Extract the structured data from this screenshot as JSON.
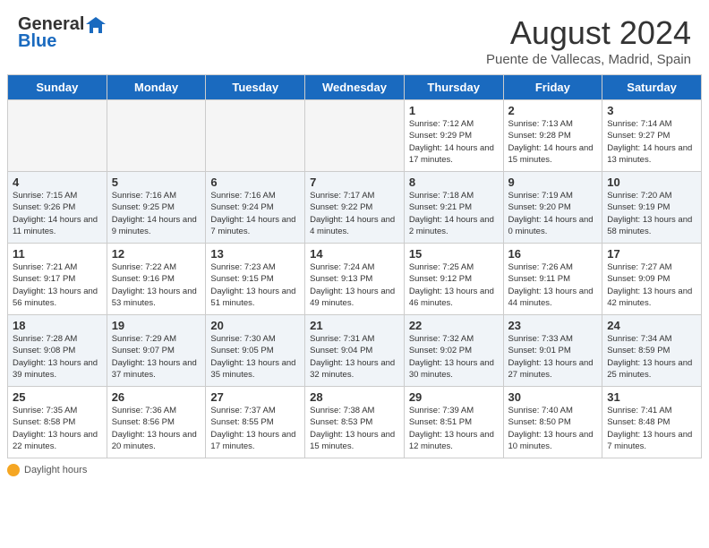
{
  "header": {
    "logo_line1": "General",
    "logo_line2": "Blue",
    "month_year": "August 2024",
    "location": "Puente de Vallecas, Madrid, Spain"
  },
  "days_of_week": [
    "Sunday",
    "Monday",
    "Tuesday",
    "Wednesday",
    "Thursday",
    "Friday",
    "Saturday"
  ],
  "weeks": [
    [
      {
        "day": "",
        "info": ""
      },
      {
        "day": "",
        "info": ""
      },
      {
        "day": "",
        "info": ""
      },
      {
        "day": "",
        "info": ""
      },
      {
        "day": "1",
        "info": "Sunrise: 7:12 AM\nSunset: 9:29 PM\nDaylight: 14 hours and 17 minutes."
      },
      {
        "day": "2",
        "info": "Sunrise: 7:13 AM\nSunset: 9:28 PM\nDaylight: 14 hours and 15 minutes."
      },
      {
        "day": "3",
        "info": "Sunrise: 7:14 AM\nSunset: 9:27 PM\nDaylight: 14 hours and 13 minutes."
      }
    ],
    [
      {
        "day": "4",
        "info": "Sunrise: 7:15 AM\nSunset: 9:26 PM\nDaylight: 14 hours and 11 minutes."
      },
      {
        "day": "5",
        "info": "Sunrise: 7:16 AM\nSunset: 9:25 PM\nDaylight: 14 hours and 9 minutes."
      },
      {
        "day": "6",
        "info": "Sunrise: 7:16 AM\nSunset: 9:24 PM\nDaylight: 14 hours and 7 minutes."
      },
      {
        "day": "7",
        "info": "Sunrise: 7:17 AM\nSunset: 9:22 PM\nDaylight: 14 hours and 4 minutes."
      },
      {
        "day": "8",
        "info": "Sunrise: 7:18 AM\nSunset: 9:21 PM\nDaylight: 14 hours and 2 minutes."
      },
      {
        "day": "9",
        "info": "Sunrise: 7:19 AM\nSunset: 9:20 PM\nDaylight: 14 hours and 0 minutes."
      },
      {
        "day": "10",
        "info": "Sunrise: 7:20 AM\nSunset: 9:19 PM\nDaylight: 13 hours and 58 minutes."
      }
    ],
    [
      {
        "day": "11",
        "info": "Sunrise: 7:21 AM\nSunset: 9:17 PM\nDaylight: 13 hours and 56 minutes."
      },
      {
        "day": "12",
        "info": "Sunrise: 7:22 AM\nSunset: 9:16 PM\nDaylight: 13 hours and 53 minutes."
      },
      {
        "day": "13",
        "info": "Sunrise: 7:23 AM\nSunset: 9:15 PM\nDaylight: 13 hours and 51 minutes."
      },
      {
        "day": "14",
        "info": "Sunrise: 7:24 AM\nSunset: 9:13 PM\nDaylight: 13 hours and 49 minutes."
      },
      {
        "day": "15",
        "info": "Sunrise: 7:25 AM\nSunset: 9:12 PM\nDaylight: 13 hours and 46 minutes."
      },
      {
        "day": "16",
        "info": "Sunrise: 7:26 AM\nSunset: 9:11 PM\nDaylight: 13 hours and 44 minutes."
      },
      {
        "day": "17",
        "info": "Sunrise: 7:27 AM\nSunset: 9:09 PM\nDaylight: 13 hours and 42 minutes."
      }
    ],
    [
      {
        "day": "18",
        "info": "Sunrise: 7:28 AM\nSunset: 9:08 PM\nDaylight: 13 hours and 39 minutes."
      },
      {
        "day": "19",
        "info": "Sunrise: 7:29 AM\nSunset: 9:07 PM\nDaylight: 13 hours and 37 minutes."
      },
      {
        "day": "20",
        "info": "Sunrise: 7:30 AM\nSunset: 9:05 PM\nDaylight: 13 hours and 35 minutes."
      },
      {
        "day": "21",
        "info": "Sunrise: 7:31 AM\nSunset: 9:04 PM\nDaylight: 13 hours and 32 minutes."
      },
      {
        "day": "22",
        "info": "Sunrise: 7:32 AM\nSunset: 9:02 PM\nDaylight: 13 hours and 30 minutes."
      },
      {
        "day": "23",
        "info": "Sunrise: 7:33 AM\nSunset: 9:01 PM\nDaylight: 13 hours and 27 minutes."
      },
      {
        "day": "24",
        "info": "Sunrise: 7:34 AM\nSunset: 8:59 PM\nDaylight: 13 hours and 25 minutes."
      }
    ],
    [
      {
        "day": "25",
        "info": "Sunrise: 7:35 AM\nSunset: 8:58 PM\nDaylight: 13 hours and 22 minutes."
      },
      {
        "day": "26",
        "info": "Sunrise: 7:36 AM\nSunset: 8:56 PM\nDaylight: 13 hours and 20 minutes."
      },
      {
        "day": "27",
        "info": "Sunrise: 7:37 AM\nSunset: 8:55 PM\nDaylight: 13 hours and 17 minutes."
      },
      {
        "day": "28",
        "info": "Sunrise: 7:38 AM\nSunset: 8:53 PM\nDaylight: 13 hours and 15 minutes."
      },
      {
        "day": "29",
        "info": "Sunrise: 7:39 AM\nSunset: 8:51 PM\nDaylight: 13 hours and 12 minutes."
      },
      {
        "day": "30",
        "info": "Sunrise: 7:40 AM\nSunset: 8:50 PM\nDaylight: 13 hours and 10 minutes."
      },
      {
        "day": "31",
        "info": "Sunrise: 7:41 AM\nSunset: 8:48 PM\nDaylight: 13 hours and 7 minutes."
      }
    ]
  ],
  "footer": {
    "daylight_label": "Daylight hours"
  }
}
